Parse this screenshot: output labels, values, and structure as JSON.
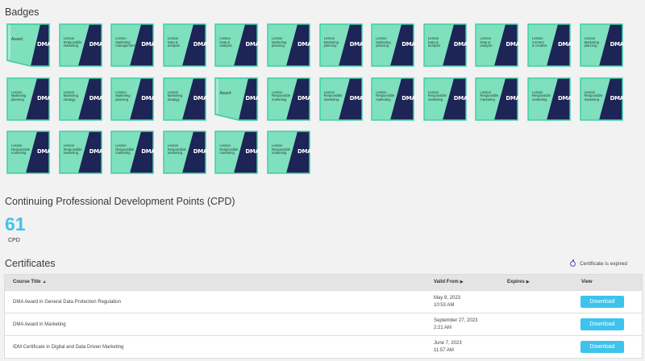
{
  "badges_section": {
    "title": "Badges",
    "dma_logo_text": "DMA",
    "badges": [
      {
        "type": "award",
        "text": "Award"
      },
      {
        "type": "lesson",
        "text": "Lesson\nResponsible\nmarketing"
      },
      {
        "type": "lesson",
        "text": "Lesson\nMarketing\nmanagement"
      },
      {
        "type": "lesson",
        "text": "Lesson\nData &\nanalysis"
      },
      {
        "type": "lesson",
        "text": "Lesson\nData &\nanalysis"
      },
      {
        "type": "lesson",
        "text": "Lesson\nMarketing\nplanning"
      },
      {
        "type": "lesson",
        "text": "Lesson\nMarketing\nplanning"
      },
      {
        "type": "lesson",
        "text": "Lesson\nMarketing\nplanning"
      },
      {
        "type": "lesson",
        "text": "Lesson\nData &\nanalysis"
      },
      {
        "type": "lesson",
        "text": "Lesson\nData &\nanalysis"
      },
      {
        "type": "lesson",
        "text": "Lesson\nContent\n& creative"
      },
      {
        "type": "lesson",
        "text": "Lesson\nMarketing\nplanning"
      },
      {
        "type": "lesson",
        "text": "Lesson\nMarketing\nplanning"
      },
      {
        "type": "lesson",
        "text": "Lesson\nMarketing\nstrategy"
      },
      {
        "type": "lesson",
        "text": "Lesson\nMarketing\nplanning"
      },
      {
        "type": "lesson",
        "text": "Lesson\nMarketing\nstrategy"
      },
      {
        "type": "award",
        "text": "Award"
      },
      {
        "type": "lesson",
        "text": "Lesson\nResponsible\nmarketing"
      },
      {
        "type": "lesson",
        "text": "Lesson\nResponsible\nmarketing"
      },
      {
        "type": "lesson",
        "text": "Lesson\nResponsible\nmarketing"
      },
      {
        "type": "lesson",
        "text": "Lesson\nResponsible\nmarketing"
      },
      {
        "type": "lesson",
        "text": "Lesson\nResponsible\nmarketing"
      },
      {
        "type": "lesson",
        "text": "Lesson\nResponsible\nmarketing"
      },
      {
        "type": "lesson",
        "text": "Lesson\nResponsible\nmarketing"
      },
      {
        "type": "lesson",
        "text": "Lesson\nResponsible\nmarketing"
      },
      {
        "type": "lesson",
        "text": "Lesson\nResponsible\nmarketing"
      },
      {
        "type": "lesson",
        "text": "Lesson\nResponsible\nmarketing"
      },
      {
        "type": "lesson",
        "text": "Lesson\nResponsible\nmarketing"
      },
      {
        "type": "lesson",
        "text": "Lesson\nResponsible\nmarketing"
      },
      {
        "type": "lesson",
        "text": "Lesson\nResponsible\nmarketing"
      }
    ]
  },
  "cpd_section": {
    "title": "Continuing Professional Development Points (CPD)",
    "value": "61",
    "label": "CPD"
  },
  "certificates_section": {
    "title": "Certificates",
    "expired_legend": "Certificate is expired",
    "columns": {
      "course_title": "Course Title",
      "valid_from": "Valid From",
      "expires": "Expires",
      "view": "View"
    },
    "rows": [
      {
        "title": "DMA Award in General Data Protection Regulation",
        "valid_date": "May 8, 2023",
        "valid_time": "10:53 AM",
        "expires": "",
        "action": "Download"
      },
      {
        "title": "DMA Award in Marketing",
        "valid_date": "September 27, 2023",
        "valid_time": "2:21 AM",
        "expires": "",
        "action": "Download"
      },
      {
        "title": "IDM Certificate in Digital and Data Driven Marketing",
        "valid_date": "June 7, 2023",
        "valid_time": "11:57 AM",
        "expires": "",
        "action": "Download"
      }
    ]
  },
  "colors": {
    "badge_mint": "#7fe0bd",
    "badge_border": "#3fcfa7",
    "badge_navy": "#1d2456",
    "accent_blue": "#42c3ea",
    "download_bg": "#3cc3ee"
  }
}
